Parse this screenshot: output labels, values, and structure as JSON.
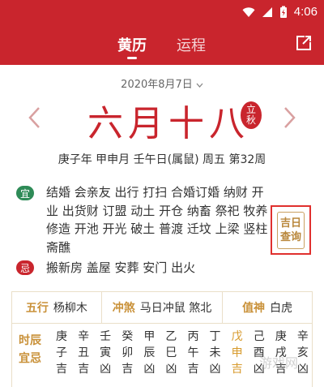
{
  "status_bar": {
    "time": "4:06"
  },
  "nav": {
    "tab_active": "黄历",
    "tab_other": "运程"
  },
  "date": {
    "solar": "2020年8月7日",
    "lunar": "六月十八",
    "solar_term_line1": "立",
    "solar_term_line2": "秋",
    "ganzhi": "庚子年 甲申月 壬午日(属鼠) 周五 第32周"
  },
  "yi": {
    "badge": "宜",
    "items": "结婚 会亲友 出行 打扫 合婚订婚 纳财 开业 出货财 订盟 动土 开仓 纳畜 祭祀 牧养 修造 开池 开光 破土 普渡 迁坟 上梁 竖柱 斋醮"
  },
  "ji": {
    "badge": "忌",
    "items": "搬新房 盖屋 安葬 安门 出火"
  },
  "jiri_button": {
    "line1": "吉日",
    "line2": "查询"
  },
  "info": {
    "wuxing_key": "五行",
    "wuxing_val": "杨柳木",
    "chongsha_key": "冲煞",
    "chongsha_val": "马日冲鼠 煞北",
    "zhishen_key": "值神",
    "zhishen_val": "白虎"
  },
  "hours": {
    "label_line1": "时辰",
    "label_line2": "宜忌",
    "columns": [
      {
        "gan": "庚",
        "zhi": "子",
        "luck": "吉"
      },
      {
        "gan": "辛",
        "zhi": "丑",
        "luck": "吉"
      },
      {
        "gan": "壬",
        "zhi": "寅",
        "luck": "凶"
      },
      {
        "gan": "癸",
        "zhi": "卯",
        "luck": "吉"
      },
      {
        "gan": "甲",
        "zhi": "辰",
        "luck": "凶"
      },
      {
        "gan": "乙",
        "zhi": "巳",
        "luck": "凶"
      },
      {
        "gan": "丙",
        "zhi": "午",
        "luck": "吉"
      },
      {
        "gan": "丁",
        "zhi": "未",
        "luck": "凶"
      },
      {
        "gan": "戊",
        "zhi": "申",
        "luck": "吉"
      },
      {
        "gan": "己",
        "zhi": "酉",
        "luck": "凶"
      },
      {
        "gan": "庚",
        "zhi": "戌",
        "luck": "吉"
      },
      {
        "gan": "辛",
        "zhi": "亥",
        "luck": "凶"
      }
    ]
  },
  "watermark": "游戏网"
}
